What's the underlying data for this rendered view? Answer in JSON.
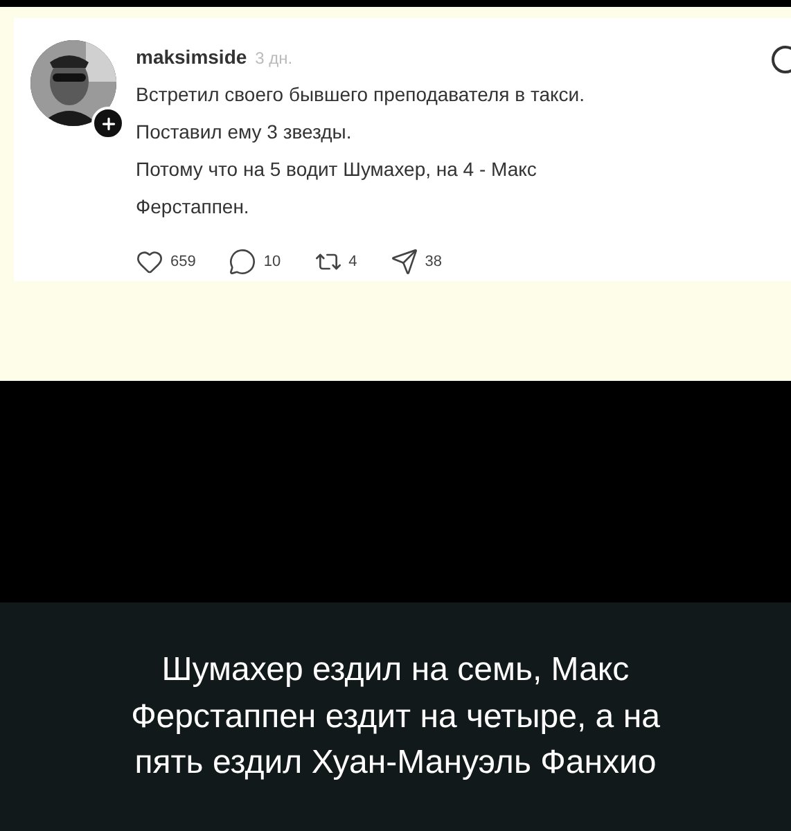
{
  "post": {
    "username": "maksimside",
    "time": "3 дн.",
    "lines": [
      "Встретил своего бывшего преподавателя в такси.",
      "Поставил ему 3 звезды.",
      "Потому что на 5 водит Шумахер, на 4 - Макс",
      "Ферстаппен."
    ],
    "actions": [
      {
        "kind": "like",
        "count": "659"
      },
      {
        "kind": "comment",
        "count": "10"
      },
      {
        "kind": "repost",
        "count": "4"
      },
      {
        "kind": "share",
        "count": "38"
      }
    ]
  },
  "caption": "Шумахер ездил на семь, Макс Ферстаппен ездит на четыре, а на пять ездил Хуан-Мануэль Фанхио"
}
